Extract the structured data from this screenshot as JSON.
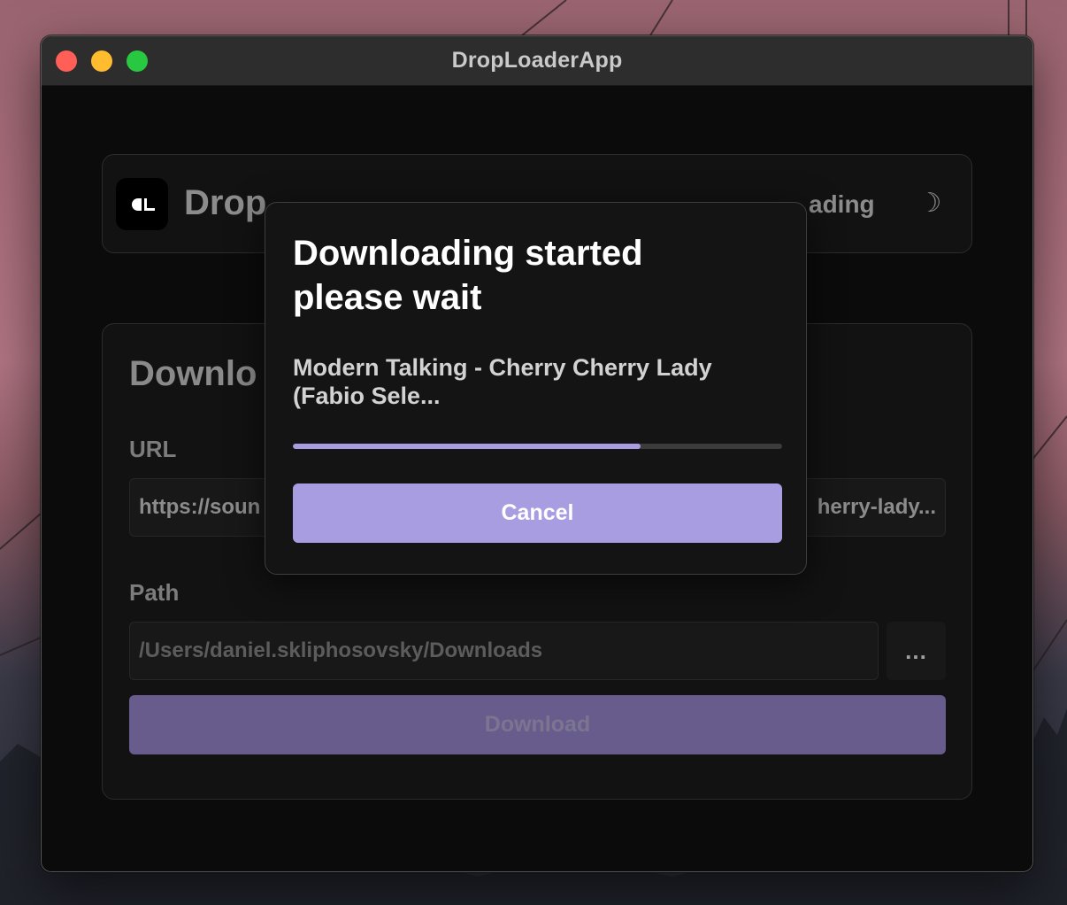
{
  "window": {
    "title": "DropLoaderApp"
  },
  "header": {
    "title": "Drop",
    "status_partial": "ading",
    "theme_toggle_icon": "moon-icon",
    "theme_toggle_glyph": "☽"
  },
  "form": {
    "section_title": "Downlo",
    "url_label": "URL",
    "url_value_start": "https://soun",
    "url_value_end": "herry-lady...",
    "path_label": "Path",
    "path_value": "/Users/daniel.skliphosovsky/Downloads",
    "browse_label": "...",
    "download_label": "Download"
  },
  "modal": {
    "title_line1": "Downloading started",
    "title_line2": "please wait",
    "track_line1": "Modern Talking - Cherry Cherry Lady",
    "track_line2": "(Fabio Sele...",
    "progress_fraction": 0.71,
    "cancel_label": "Cancel"
  },
  "colors": {
    "accent": "#a99de1",
    "accent_disabled": "#685c8c",
    "window_bg": "#0b0b0b",
    "traffic_close": "#ff5f57",
    "traffic_minimize": "#febc2e",
    "traffic_maximize": "#28c840"
  }
}
